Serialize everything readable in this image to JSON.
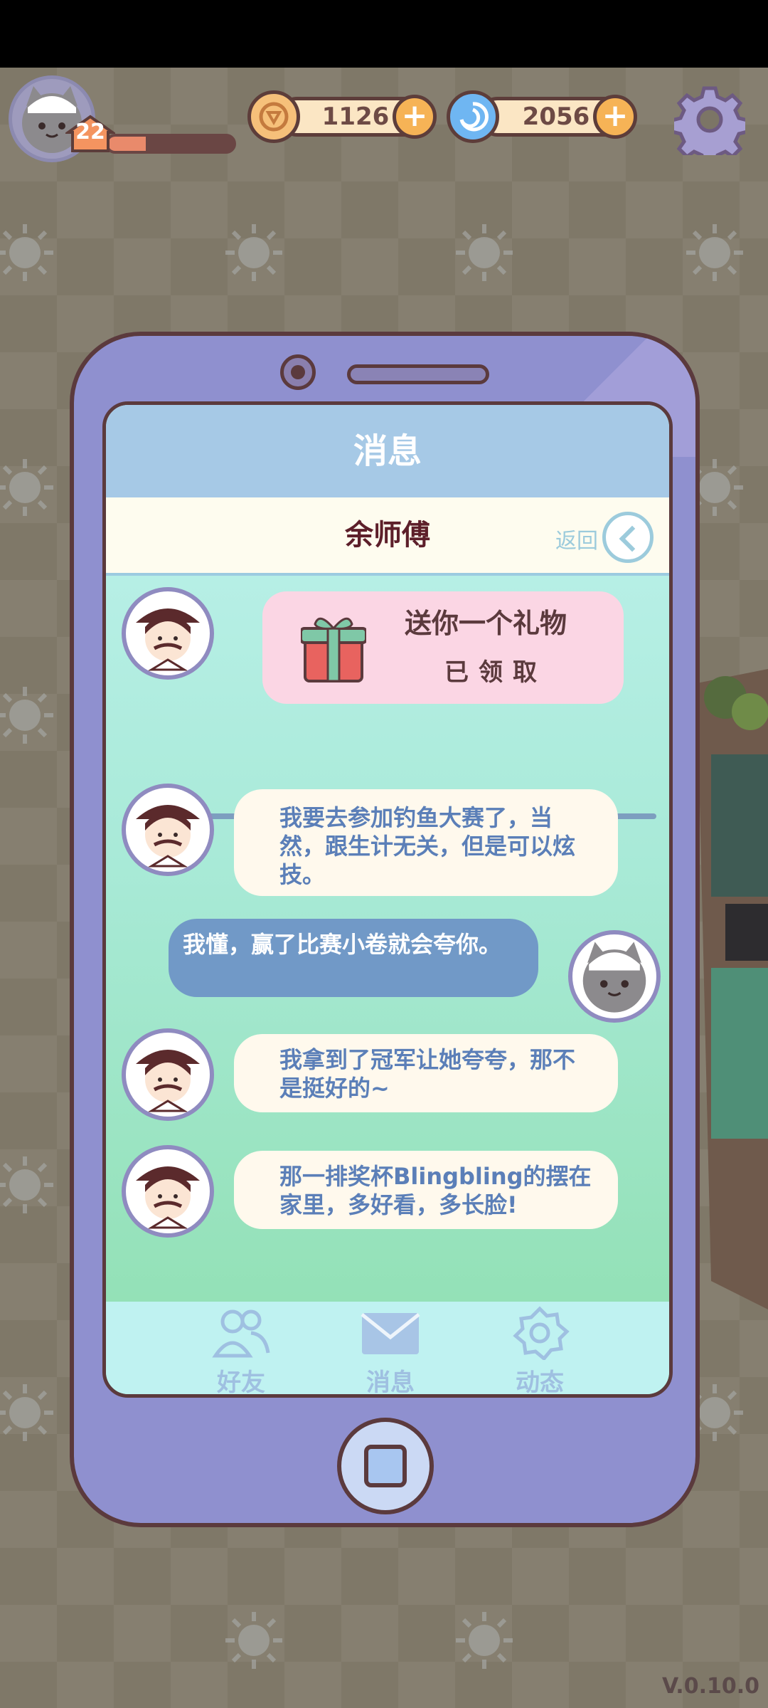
{
  "hud": {
    "level": "22",
    "xp_progress": 0.3,
    "coins": "1126",
    "gems": "2056"
  },
  "phone": {
    "title": "消息",
    "contact_name": "余师傅",
    "back_label": "返回",
    "gift": {
      "title": "送你一个礼物",
      "status": "已领取"
    },
    "messages": [
      {
        "from": "contact",
        "text": "我要去参加钓鱼大赛了，当然，跟生计无关，但是可以炫技。"
      },
      {
        "from": "me",
        "text": "我懂，赢了比赛小卷就会夸你。"
      },
      {
        "from": "contact",
        "text": "我拿到了冠军让她夸夸，那不是挺好的~"
      },
      {
        "from": "contact",
        "text": "那一排奖杯Blingbling的摆在家里，多好看，多长脸!"
      }
    ],
    "tabs": [
      {
        "label": "好友",
        "icon": "friends-icon"
      },
      {
        "label": "消息",
        "icon": "mail-icon"
      },
      {
        "label": "动态",
        "icon": "moments-icon"
      }
    ]
  },
  "version": "V.0.10.0",
  "colors": {
    "screen_header": "#a6c9e6",
    "bubble_left": "#fff9ed",
    "bubble_right": "#7199c7",
    "phone_body": "#8f90cf",
    "outline": "#5b3a3d"
  }
}
